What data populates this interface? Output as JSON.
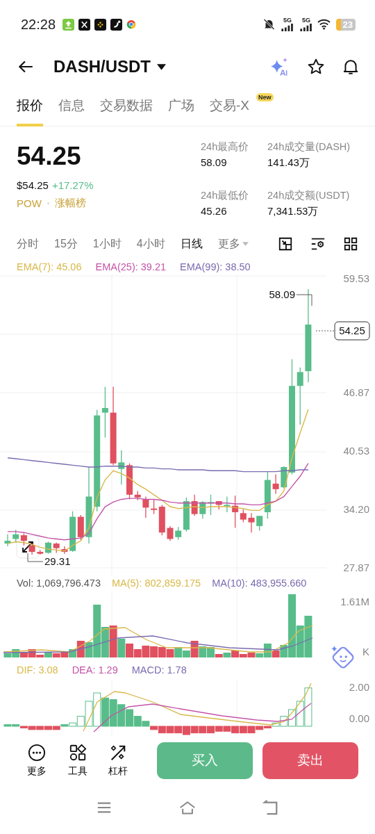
{
  "status_bar": {
    "time": "22:28",
    "network_labels": [
      "5G",
      "5G"
    ],
    "battery": "23"
  },
  "header": {
    "title": "DASH/USDT"
  },
  "tabs": [
    {
      "label": "报价",
      "selected": true
    },
    {
      "label": "信息",
      "selected": false
    },
    {
      "label": "交易数据",
      "selected": false
    },
    {
      "label": "广场",
      "selected": false
    },
    {
      "label": "交易-X",
      "selected": false,
      "badge": "New"
    }
  ],
  "price": {
    "last": "54.25",
    "usd": "$54.25",
    "change": "+17.27%",
    "tags": [
      "POW",
      "涨幅榜"
    ]
  },
  "stats": [
    {
      "label": "24h最高价",
      "value": "58.09"
    },
    {
      "label": "24h成交量(DASH)",
      "value": "141.43万"
    },
    {
      "label": "24h最低价",
      "value": "45.26"
    },
    {
      "label": "24h成交额(USDT)",
      "value": "7,341.53万"
    }
  ],
  "intervals": [
    {
      "label": "分时",
      "selected": false
    },
    {
      "label": "15分",
      "selected": false
    },
    {
      "label": "1小时",
      "selected": false
    },
    {
      "label": "4小时",
      "selected": false
    },
    {
      "label": "日线",
      "selected": true
    }
  ],
  "more_intervals": "更多",
  "price_chart": {
    "indicators": [
      {
        "label": "EMA(7): 45.06",
        "color": "#d9b84a"
      },
      {
        "label": "EMA(25): 39.21",
        "color": "#c454a8"
      },
      {
        "label": "EMA(99): 38.50",
        "color": "#7b6bb0"
      }
    ],
    "chart_data": {
      "type": "candlestick",
      "grid": true,
      "ylim": [
        27.87,
        59.53
      ],
      "ohlc": [
        [
          30.5,
          31.5,
          30.2,
          30.8
        ],
        [
          31,
          32,
          30.6,
          31.5
        ],
        [
          31.4,
          31.6,
          30.3,
          30.8
        ],
        [
          30.3,
          30.5,
          29.3,
          29.6
        ],
        [
          29.6,
          29.8,
          29.31,
          29.4
        ],
        [
          29.5,
          30.7,
          29.4,
          30.6
        ],
        [
          30.5,
          30.6,
          29.5,
          30
        ],
        [
          29.9,
          30.2,
          29.4,
          29.6
        ],
        [
          29.7,
          34,
          29.6,
          33.4
        ],
        [
          33.4,
          33.6,
          30.9,
          31.2
        ],
        [
          31.2,
          38.8,
          30.5,
          35.6
        ],
        [
          34.5,
          45,
          34,
          44.4
        ],
        [
          44.7,
          47.5,
          42,
          45.2
        ],
        [
          44.7,
          47.5,
          39,
          39.2
        ],
        [
          38.6,
          40.6,
          36.9,
          39.3
        ],
        [
          39,
          39.2,
          35.3,
          35.8
        ],
        [
          35.8,
          36.2,
          35.2,
          35.5
        ],
        [
          35.3,
          35.6,
          33.3,
          34.4
        ],
        [
          34.3,
          35.3,
          33.7,
          34.2
        ],
        [
          34.5,
          34.7,
          31.4,
          31.7
        ],
        [
          32.2,
          32.4,
          30.8,
          31
        ],
        [
          31.2,
          32.3,
          30.9,
          31.9
        ],
        [
          32,
          35.5,
          31.8,
          35.1
        ],
        [
          35.1,
          35.8,
          33.5,
          33.7
        ],
        [
          33.7,
          35.1,
          33.2,
          35
        ],
        [
          34.9,
          35.8,
          33.6,
          35
        ],
        [
          35.1,
          35.1,
          34.2,
          34.7
        ],
        [
          34.6,
          35.6,
          33.9,
          34.7
        ],
        [
          34.6,
          35.7,
          32.2,
          33.9
        ],
        [
          33.8,
          34.2,
          32.8,
          33.1
        ],
        [
          33.3,
          33.8,
          31.7,
          32.8
        ],
        [
          32.4,
          33.5,
          31.9,
          33.5
        ],
        [
          33.9,
          38.3,
          33.2,
          37.4
        ],
        [
          37,
          38,
          35.9,
          36.4
        ],
        [
          36.6,
          38.9,
          36.5,
          38.8
        ],
        [
          38.2,
          50.5,
          38,
          47.6
        ],
        [
          47.6,
          49.6,
          43.4,
          49.1
        ],
        [
          49.2,
          58.09,
          48,
          54.25
        ]
      ],
      "yticks": [
        {
          "value": 59.53,
          "label": "59.53"
        },
        {
          "value": 46.87,
          "label": "46.87"
        },
        {
          "value": 40.53,
          "label": "40.53"
        },
        {
          "value": 34.2,
          "label": "34.20"
        },
        {
          "value": 27.87,
          "label": "27.87"
        }
      ],
      "series": [
        {
          "type": "line",
          "color": "#d9b84a",
          "values": [
            30.5,
            30.7,
            30.6,
            30.4,
            30.1,
            29.9,
            29.8,
            29.7,
            30.3,
            30.8,
            32.2,
            35.5,
            37.4,
            38.4,
            38.1,
            37.6,
            36.9,
            36.4,
            35.8,
            35.2,
            34.5,
            34.3,
            34.4,
            34.5,
            34.4,
            34.5,
            34.5,
            34.5,
            34.4,
            34.3,
            34.1,
            34.1,
            34.7,
            35.1,
            36.2,
            39.8,
            42.5,
            45.06
          ]
        },
        {
          "type": "line",
          "color": "#c454a8",
          "values": [
            31.8,
            31.8,
            31.7,
            31.5,
            31.3,
            31.1,
            31.0,
            30.9,
            31.0,
            31.1,
            31.6,
            33.2,
            34.5,
            35.0,
            35.3,
            35.4,
            35.4,
            35.3,
            35.3,
            35.2,
            35.0,
            34.9,
            34.9,
            34.9,
            34.9,
            34.9,
            34.9,
            34.9,
            34.8,
            34.8,
            34.7,
            34.7,
            34.9,
            35.1,
            35.6,
            36.7,
            37.8,
            39.21
          ]
        },
        {
          "type": "line",
          "color": "#7b6bb0",
          "values": [
            39.8,
            39.7,
            39.6,
            39.5,
            39.4,
            39.3,
            39.2,
            39.1,
            39.0,
            38.9,
            38.8,
            38.8,
            38.9,
            38.9,
            38.9,
            38.8,
            38.8,
            38.7,
            38.7,
            38.6,
            38.6,
            38.5,
            38.5,
            38.5,
            38.5,
            38.4,
            38.4,
            38.4,
            38.4,
            38.3,
            38.3,
            38.3,
            38.3,
            38.3,
            38.4,
            38.4,
            38.5,
            38.5
          ]
        }
      ]
    },
    "high_label": "58.09",
    "low_label": "29.31",
    "last_label": "54.25"
  },
  "volume_chart": {
    "indicators": [
      {
        "label": "Vol: 1,069,796.473",
        "color": "#555555"
      },
      {
        "label": "MA(5): 802,859.175",
        "color": "#d9b84a"
      },
      {
        "label": "MA(10): 483,955.660",
        "color": "#7b6bb0"
      }
    ],
    "axis_labels": [
      "1.61M"
    ],
    "side_label": "K"
  },
  "macd_chart": {
    "indicators": [
      {
        "label": "DIF: 3.08",
        "color": "#d9b84a"
      },
      {
        "label": "DEA: 1.29",
        "color": "#c454a8"
      },
      {
        "label": "MACD: 1.78",
        "color": "#7b6bb0"
      }
    ],
    "axis_labels": [
      "2.00",
      "0.00"
    ]
  },
  "toolbar": [
    {
      "label": "更多",
      "kind": "more"
    },
    {
      "label": "工具",
      "kind": "tools"
    },
    {
      "label": "杠杆",
      "kind": "leverage"
    }
  ],
  "actions": [
    {
      "label": "买入",
      "kind": "buy"
    },
    {
      "label": "卖出",
      "kind": "sell"
    }
  ]
}
